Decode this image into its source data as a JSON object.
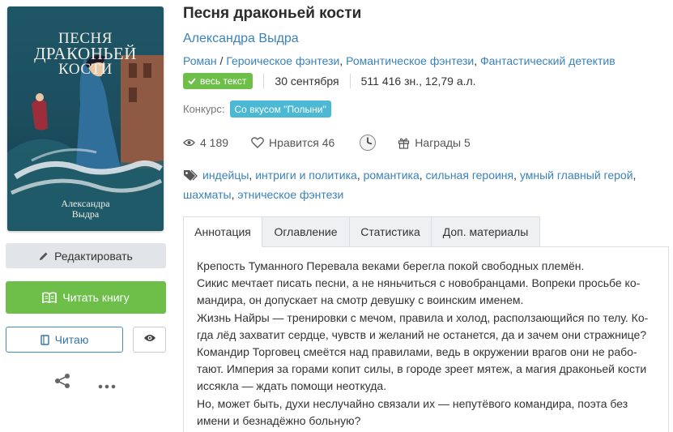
{
  "book": {
    "title": "Песня драконьей кости",
    "author": "Александра Выдра",
    "cover": {
      "title_line1": "Песня",
      "title_line2": "драконьей",
      "title_line3": "кости",
      "author_line1": "Александра",
      "author_line2": "Выдра"
    },
    "form": "Роман",
    "genres": [
      "Героическое фэнтези",
      "Романтическое фэнтези",
      "Фантастический детектив"
    ],
    "status_badge": "весь текст",
    "date": "30 сентября",
    "size": "511 416 зн., 12,79 а.л.",
    "contest_label": "Конкурс:",
    "contest_name": "Со вкусом \"Полыни\""
  },
  "stats": {
    "views": "4 189",
    "likes_label": "Нравится 46",
    "awards_label": "Награды 5"
  },
  "tags": [
    "индейцы",
    "интриги и политика",
    "романтика",
    "сильная героиня",
    "умный главный герой",
    "шахматы",
    "этническое фэнтези"
  ],
  "actions": {
    "edit_label": "Редактировать",
    "read_label": "Читать книгу",
    "reading_label": "Читаю"
  },
  "tabs": [
    "Аннотация",
    "Оглавление",
    "Статистика",
    "Доп. материалы"
  ],
  "annotation": [
    "Крепость Туманного Перевала веками берегла покой свободных племён.",
    "Сикис мечтает писать песни, а не няньчиться с новобранцами. Вопреки просьбе ко-",
    "мандира, он допускает на смотр девушку с воинским именем.",
    "Жизнь Найры — тренировки с мечом, правила и холод, расползающийся по телу. Ко-",
    "гда лёд захватит сердце, чувств и желаний не останется, да и зачем они стражнице?",
    "Командир Торговец смеётся над правилами, ведь в окружении врагов они не рабо-",
    "тают. Империя за горами копит силы, в городе зреет мятеж, а магия драконьей кости",
    "иссякла — ждать помощи неоткуда.",
    "Но, может быть, духи неслучайно связали их — непутёвого командира, поэта без",
    "имени и безнадёжно больную?"
  ],
  "colors": {
    "link": "#3a82b9",
    "green": "#6dbf4a",
    "contest": "#4bb8d4"
  }
}
